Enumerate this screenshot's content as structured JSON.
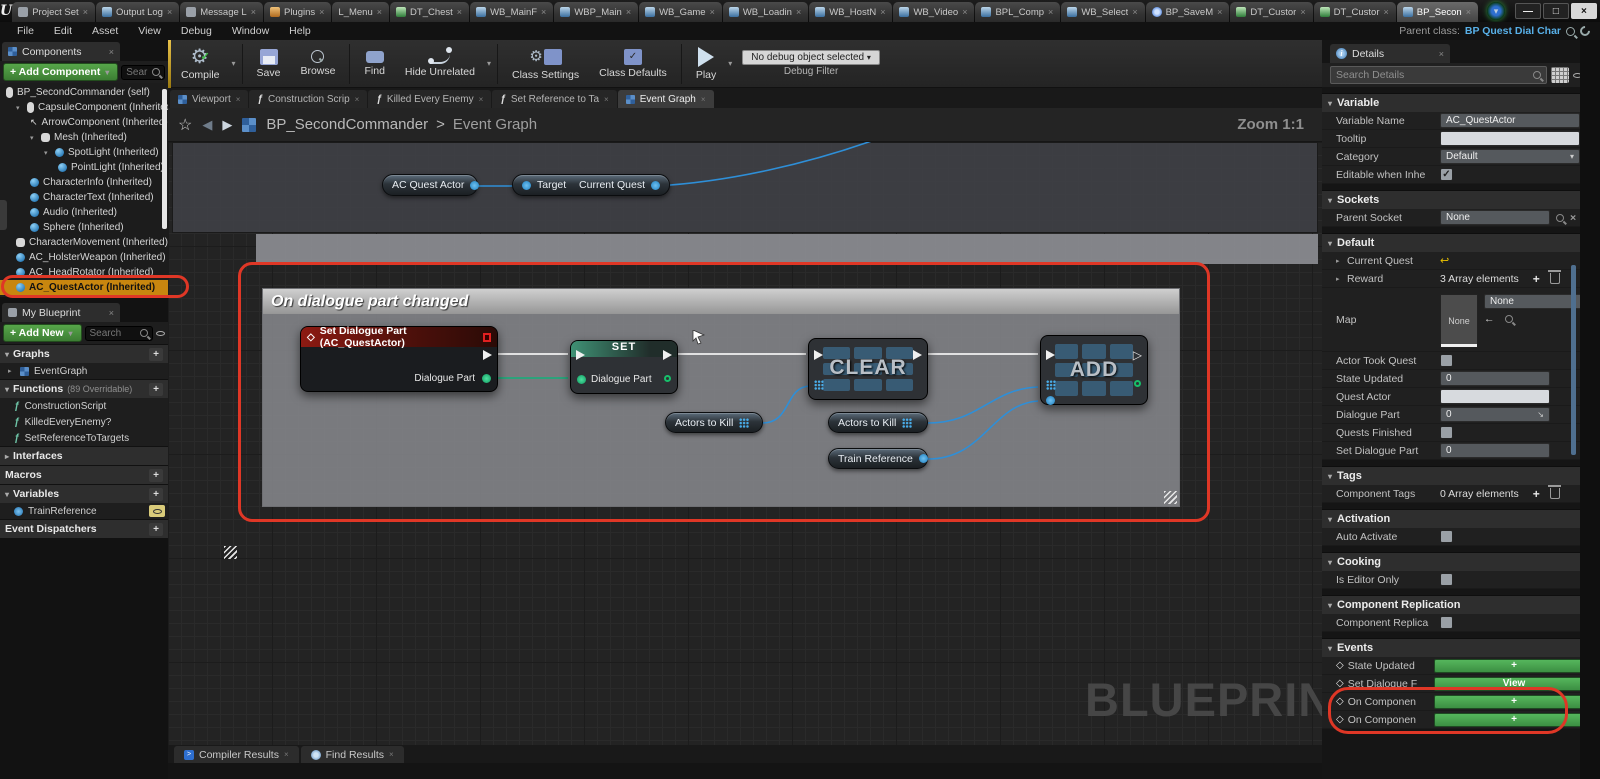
{
  "icons": {
    "logo": "U",
    "close": "×",
    "win_min": "—",
    "win_max": "□",
    "win_close": "×",
    "tri_down": "▾",
    "tri_right": "▸",
    "star": "☆",
    "nav_back": "◀",
    "nav_fwd": "▶",
    "crumb_sep": ">",
    "fn": "ƒ",
    "plus": "+",
    "diamond": "◇",
    "check": "✓",
    "gear": "⚙",
    "revert": "↩",
    "expand": "↘",
    "arrow_back": "←",
    "dropdown": "▾",
    "arrow_nw": "↖",
    "exec_hollow": "▷",
    "console": ">"
  },
  "colors": {
    "selection_orange": "#C8860F",
    "annotation_red": "#DF3726",
    "pin_blue": "#3CA4E8",
    "pin_green": "#17C06B",
    "exec_white": "#F0F0F0",
    "button_green": "#4CAF50",
    "parent_class_link": "#58B0E8",
    "comment_gray": "#8C8D92"
  },
  "window": {
    "tabs": [
      {
        "label": "Project Set"
      },
      {
        "label": "Output Log"
      },
      {
        "label": "Message L"
      },
      {
        "label": "Plugins"
      },
      {
        "label": "L_Menu"
      },
      {
        "label": "DT_Chest"
      },
      {
        "label": "WB_MainF"
      },
      {
        "label": "WBP_Main"
      },
      {
        "label": "WB_Game"
      },
      {
        "label": "WB_Loadin"
      },
      {
        "label": "WB_HostN"
      },
      {
        "label": "WB_Video"
      },
      {
        "label": "BPL_Comp"
      },
      {
        "label": "WB_Select"
      },
      {
        "label": "BP_SaveM"
      },
      {
        "label": "DT_Custor"
      },
      {
        "label": "DT_Custor"
      },
      {
        "label": "BP_Secon"
      }
    ]
  },
  "menubar": {
    "items": [
      "File",
      "Edit",
      "Asset",
      "View",
      "Debug",
      "Window",
      "Help"
    ],
    "parent_class_label": "Parent class:",
    "parent_class_value": "BP Quest Dial Char"
  },
  "toolbar": {
    "compile": "Compile",
    "save": "Save",
    "browse": "Browse",
    "find": "Find",
    "hide_unrelated": "Hide Unrelated",
    "class_settings": "Class Settings",
    "class_defaults": "Class Defaults",
    "play": "Play",
    "debug_value": "No debug object selected",
    "debug_label": "Debug Filter"
  },
  "components": {
    "tab": "Components",
    "add": "+ Add Component",
    "search": "Sear",
    "items": [
      {
        "label": "BP_SecondCommander (self)"
      },
      {
        "label": "CapsuleComponent (Inherited)"
      },
      {
        "label": "ArrowComponent (Inherited)"
      },
      {
        "label": "Mesh (Inherited)"
      },
      {
        "label": "SpotLight (Inherited)"
      },
      {
        "label": "PointLight (Inherited)"
      },
      {
        "label": "CharacterInfo (Inherited)"
      },
      {
        "label": "CharacterText (Inherited)"
      },
      {
        "label": "Audio (Inherited)"
      },
      {
        "label": "Sphere (Inherited)"
      },
      {
        "label": "CharacterMovement (Inherited)"
      },
      {
        "label": "AC_HolsterWeapon (Inherited)"
      },
      {
        "label": "AC_HeadRotator (Inherited)"
      },
      {
        "label": "AC_QuestActor (Inherited)"
      }
    ]
  },
  "my_blueprint": {
    "tab": "My Blueprint",
    "add": "+ Add New",
    "search": "Search",
    "graphs": "Graphs",
    "eventgraph": "EventGraph",
    "functions": "Functions",
    "functions_note": "(89 Overridable)",
    "fn1": "ConstructionScript",
    "fn2": "KilledEveryEnemy?",
    "fn3": "SetReferenceToTargets",
    "interfaces": "Interfaces",
    "macros": "Macros",
    "variables": "Variables",
    "var1": "TrainReference",
    "dispatchers": "Event Dispatchers"
  },
  "graph": {
    "tabs": [
      {
        "label": "Viewport"
      },
      {
        "label": "Construction Scrip"
      },
      {
        "label": "Killed Every Enemy"
      },
      {
        "label": "Set Reference to Ta"
      },
      {
        "label": "Event Graph"
      }
    ],
    "breadcrumb_root": "BP_SecondCommander",
    "breadcrumb_current": "Event Graph",
    "zoom": "Zoom 1:1",
    "comment": "On dialogue part changed",
    "watermark": "BLUEPRINT",
    "nodes": {
      "event_title": "Set Dialogue Part (AC_QuestActor)",
      "event_pin": "Dialogue Part",
      "set_title": "SET",
      "set_pin": "Dialogue Part",
      "clear_title": "CLEAR",
      "add_title": "ADD",
      "get1": "AC Quest Actor",
      "target": "Target",
      "current_quest": "Current Quest",
      "actors_to_kill_1": "Actors to Kill",
      "actors_to_kill_2": "Actors to Kill",
      "train_reference": "Train Reference"
    }
  },
  "bottom": {
    "tab1": "Compiler Results",
    "tab2": "Find Results"
  },
  "details": {
    "tab": "Details",
    "search": "Search Details",
    "variable": {
      "title": "Variable",
      "name_label": "Variable Name",
      "name_value": "AC_QuestActor",
      "tooltip_label": "Tooltip",
      "category_label": "Category",
      "category_value": "Default",
      "editable_label": "Editable when Inhe"
    },
    "sockets": {
      "title": "Sockets",
      "parent_label": "Parent Socket",
      "parent_value": "None"
    },
    "default": {
      "title": "Default",
      "current_quest": "Current Quest",
      "reward": "Reward",
      "reward_value": "3 Array elements",
      "map": "Map",
      "map_thumb": "None",
      "map_value": "None",
      "actor_took": "Actor Took Quest",
      "state_updated": "State Updated",
      "state_value": "0",
      "quest_actor": "Quest Actor",
      "dialogue_part": "Dialogue Part",
      "dialogue_value": "0",
      "quests_finished": "Quests Finished",
      "set_dialogue": "Set Dialogue Part",
      "set_value": "0"
    },
    "tags": {
      "title": "Tags",
      "label": "Component Tags",
      "value": "0 Array elements"
    },
    "activation": {
      "title": "Activation",
      "label": "Auto Activate"
    },
    "cooking": {
      "title": "Cooking",
      "label": "Is Editor Only"
    },
    "replication": {
      "title": "Component Replication",
      "label": "Component Replica"
    },
    "events": {
      "title": "Events",
      "rows": [
        {
          "label": "State Updated",
          "button": "+"
        },
        {
          "label": "Set Dialogue F",
          "button": "View"
        },
        {
          "label": "On Componen",
          "button": "+"
        },
        {
          "label": "On Componen",
          "button": "+"
        }
      ]
    }
  }
}
